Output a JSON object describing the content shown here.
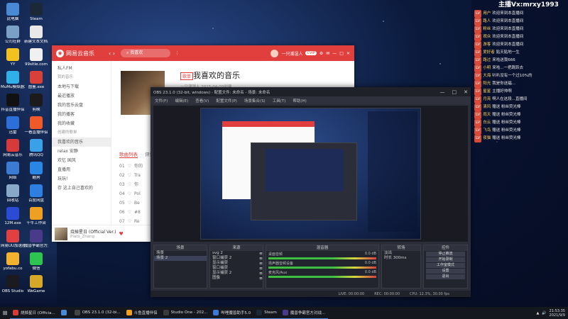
{
  "desktop": {
    "icons": [
      {
        "label": "此电脑",
        "color": "#4a8ad4"
      },
      {
        "label": "Steam",
        "color": "#1b2838"
      },
      {
        "label": "公司社群",
        "color": "#7aa0c8"
      },
      {
        "label": "新建文本文档.txt",
        "color": "#e8e8e8"
      },
      {
        "label": "YY",
        "color": "#f3c21f"
      },
      {
        "label": "99sitie.com",
        "color": "#f0f0f0"
      },
      {
        "label": "MuMu模拟器X",
        "color": "#2fb0e8"
      },
      {
        "label": "图鉴.exe",
        "color": "#d9403a"
      },
      {
        "label": "抖音直播伴侣",
        "color": "#111111"
      },
      {
        "label": "剪映",
        "color": "#1b1b1b"
      },
      {
        "label": "迅雷",
        "color": "#2c6fd8"
      },
      {
        "label": "一看直播伴侣",
        "color": "#f05a28"
      },
      {
        "label": "网易云音乐",
        "color": "#d73a3a"
      },
      {
        "label": "腾讯QQ",
        "color": "#3aa0e8"
      },
      {
        "label": "网络",
        "color": "#3b7bd4"
      },
      {
        "label": "酷狗",
        "color": "#2a86e3"
      },
      {
        "label": "回收站",
        "color": "#8aa8c8"
      },
      {
        "label": "百度网盘",
        "color": "#2f7fe0"
      },
      {
        "label": "12M.exe",
        "color": "#2b4bd6"
      },
      {
        "label": "千牛工作台",
        "color": "#f0a020"
      },
      {
        "label": "网易UU加速器",
        "color": "#e04040"
      },
      {
        "label": "魔兽争霸官方对战平台",
        "color": "#4a3a8a"
      },
      {
        "label": "yofabu.co",
        "color": "#f2b230"
      },
      {
        "label": "微信",
        "color": "#2dc44f"
      },
      {
        "label": "OBS Studio",
        "color": "#1b1b1f"
      },
      {
        "label": "WeGame",
        "color": "#d6a82a"
      }
    ]
  },
  "ncm": {
    "app_name": "网易云音乐",
    "search_placeholder": "我喜欢",
    "username": "一只潮湿人",
    "vip": "CVIP",
    "sidebar": [
      {
        "label": "私人FM",
        "kind": "item"
      },
      {
        "label": "我的音乐",
        "kind": "sec"
      },
      {
        "label": "本地与下载",
        "kind": "item"
      },
      {
        "label": "最近播放",
        "kind": "item"
      },
      {
        "label": "我的音乐云盘",
        "kind": "item"
      },
      {
        "label": "我的播客",
        "kind": "item"
      },
      {
        "label": "我的收藏",
        "kind": "item"
      },
      {
        "label": "创建的歌单",
        "kind": "sec"
      },
      {
        "label": "我喜欢的音乐",
        "kind": "act"
      },
      {
        "label": "relax 安静",
        "kind": "item"
      },
      {
        "label": "欢忆 国风",
        "kind": "item"
      },
      {
        "label": "直播用",
        "kind": "item"
      },
      {
        "label": "玩玩!",
        "kind": "item"
      },
      {
        "label": "存 这上自己喜欢的",
        "kind": "item"
      }
    ],
    "playlist": {
      "tag": "歌单",
      "title": "我喜欢的音乐",
      "meta": "一只潮湿人  2015-04-09创建"
    },
    "tabs": [
      "歌曲列表",
      "评论"
    ],
    "songs": [
      {
        "num": "01",
        "name": "你的"
      },
      {
        "num": "02",
        "name": "Tra"
      },
      {
        "num": "03",
        "name": "你"
      },
      {
        "num": "04",
        "name": "Pol"
      },
      {
        "num": "05",
        "name": "Be"
      },
      {
        "num": "06",
        "name": "#8"
      },
      {
        "num": "07",
        "name": "Re"
      }
    ],
    "player": {
      "song": "烧掉星日 (Official Ver.)",
      "artist": "Plato_Zhang"
    }
  },
  "obs": {
    "title": "OBS 23.1.0 (32-bit, windows) - 配置文件: 未命名 - 场景: 未命名",
    "menu": [
      "文件(F)",
      "编辑(E)",
      "查看(V)",
      "配置文件(P)",
      "场景集合(S)",
      "工具(T)",
      "帮助(H)"
    ],
    "panels": {
      "scenes": {
        "title": "场景",
        "items": [
          "场景",
          "场景 2"
        ]
      },
      "sources": {
        "title": "来源",
        "items": [
          "svg 2",
          "窗口捕获 2",
          "显示捕获",
          "窗口捕获",
          "显示捕获 2",
          "图像"
        ]
      },
      "mixer": {
        "title": "混音器",
        "channels": [
          {
            "name": "桌面音频",
            "db": "0.0 dB"
          },
          {
            "name": "扬声器音频设备",
            "db": "0.0 dB"
          },
          {
            "name": "麦克风/Aux",
            "db": "0.0 dB"
          }
        ]
      },
      "transitions": {
        "title": "转场",
        "type": "淡出",
        "duration_label": "时长",
        "duration": "300ms"
      },
      "controls": {
        "title": "控件",
        "buttons": [
          "停止推流",
          "开始录制",
          "工作室模式",
          "设置",
          "退出"
        ]
      }
    },
    "status": {
      "live": "LIVE: 00:00:00",
      "rec": "REC: 00:00:00",
      "cpu": "CPU: 12.3%, 30.00 fps"
    }
  },
  "chat": {
    "header": "主播Vx:mrxy1993",
    "messages": [
      {
        "badge": "LV",
        "name": "用户",
        "text": "欢迎来到本直播间"
      },
      {
        "badge": "LV",
        "name": "路人",
        "text": "欢迎来到本直播间"
      },
      {
        "badge": "LV",
        "name": "粉丝",
        "text": "欢迎来到本直播间"
      },
      {
        "badge": "LV",
        "name": "观众",
        "text": "欢迎来到本直播间"
      },
      {
        "badge": "LV",
        "name": "游客",
        "text": "欢迎来到本直播间"
      },
      {
        "badge": "LV",
        "name": "爱好者",
        "text": "贴天贴地一生"
      },
      {
        "badge": "LV",
        "name": "路过",
        "text": "来啦送我666"
      },
      {
        "badge": "LV",
        "name": "小明",
        "text": "来啦...一把跳跃去"
      },
      {
        "badge": "LV",
        "name": "大海",
        "text": "叭叭没有一个过10%的"
      },
      {
        "badge": "LV",
        "name": "阳光",
        "text": "我是你送福..."
      },
      {
        "badge": "LV",
        "name": "星星",
        "text": "主播好帅啊"
      },
      {
        "badge": "LV",
        "name": "月亮",
        "text": "啊人在这段...直播间"
      },
      {
        "badge": "LV",
        "name": "清风",
        "text": "赠送 粉丝荧光棒"
      },
      {
        "badge": "LV",
        "name": "雨天",
        "text": "赠送 粉丝荧光棒"
      },
      {
        "badge": "LV",
        "name": "白云",
        "text": "赠送 粉丝荧光棒"
      },
      {
        "badge": "LV",
        "name": "飞鸟",
        "text": "赠送 粉丝荧光棒"
      },
      {
        "badge": "LV",
        "name": "夜猫",
        "text": "赠送 粉丝荧光棒"
      }
    ]
  },
  "taskbar": {
    "items": [
      {
        "label": "烧掉星日 (Officia...",
        "color": "#d73a3a"
      },
      {
        "label": "",
        "color": "#4a8ad4"
      },
      {
        "label": "OBS 23.1.0 (32-bi...",
        "color": "#444444"
      },
      {
        "label": "斗鱼直播伴侣",
        "color": "#f0a020"
      },
      {
        "label": "Studio One - 202...",
        "color": "#3a3a3a"
      },
      {
        "label": "哔哩魔兽助手5.0",
        "color": "#3a7ad6"
      },
      {
        "label": "Steam",
        "color": "#1b2838"
      },
      {
        "label": "魔兽争霸官方对战...",
        "color": "#4a3a8a"
      }
    ],
    "time": "21:53:35",
    "date": "2021/9/9"
  }
}
